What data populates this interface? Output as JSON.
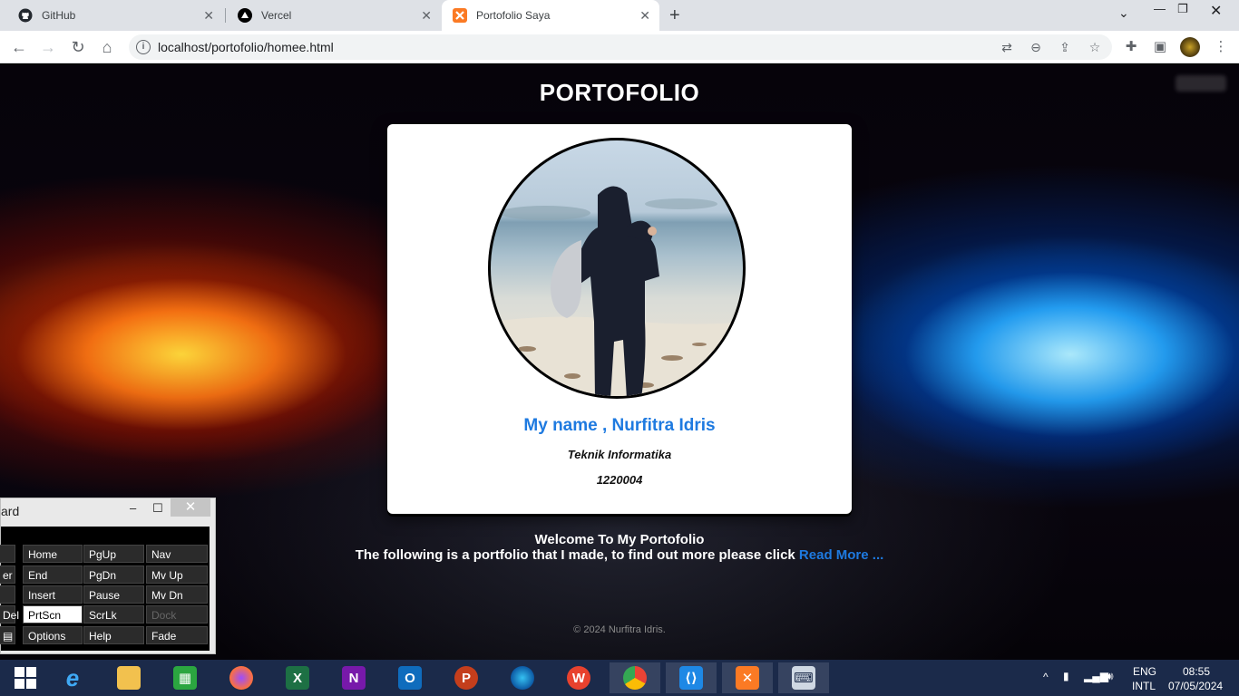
{
  "browser": {
    "tabs": [
      {
        "label": "GitHub",
        "icon": "github-icon"
      },
      {
        "label": "Vercel",
        "icon": "vercel-icon"
      },
      {
        "label": "Portofolio Saya",
        "icon": "xampp-icon",
        "active": true
      }
    ],
    "url": "localhost/portofolio/homee.html"
  },
  "page": {
    "title": "PORTOFOLIO",
    "card": {
      "name": "My name , Nurfitra Idris",
      "major": "Teknik Informatika",
      "student_id": "1220004"
    },
    "welcome": "Welcome To My Portofolio",
    "intro": "The following is a portfolio that I made, to find out more please click",
    "read_more": "Read More ...",
    "footer": "© 2024 Nurfitra Idris."
  },
  "osk": {
    "title": "ard",
    "keys": [
      [
        "Home",
        "PgUp",
        "Nav"
      ],
      [
        "End",
        "PgDn",
        "Mv Up"
      ],
      [
        "Insert",
        "Pause",
        "Mv Dn"
      ],
      [
        "PrtScn",
        "ScrLk",
        "Dock"
      ],
      [
        "Options",
        "Help",
        "Fade"
      ]
    ],
    "left_keys": [
      "",
      "er",
      "",
      "Del",
      ""
    ]
  },
  "taskbar": {
    "lang_top": "ENG",
    "lang_bottom": "INTL",
    "time": "08:55",
    "date": "07/05/2024"
  },
  "colors": {
    "accent": "#1e7ae0",
    "taskbar": "#1b2a4a"
  }
}
